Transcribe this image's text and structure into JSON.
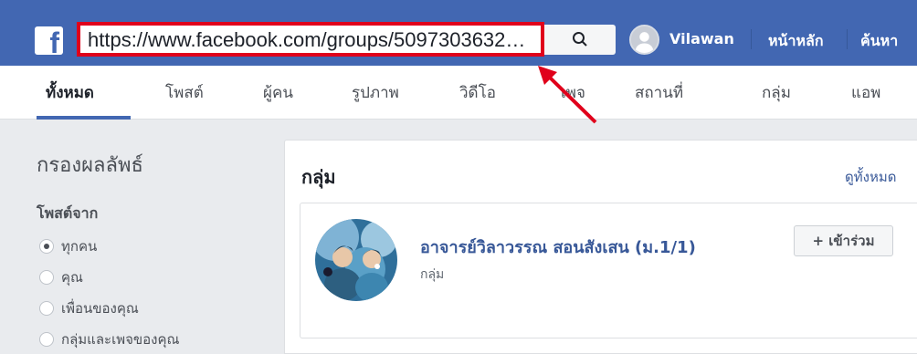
{
  "header": {
    "logo_letter": "f",
    "url": "https://www.facebook.com/groups/5097303632…",
    "user_name": "Vilawan",
    "home_label": "หน้าหลัก",
    "find_label": "ค้นหา"
  },
  "tabs": [
    {
      "label": "ทั้งหมด"
    },
    {
      "label": "โพสต์"
    },
    {
      "label": "ผู้คน"
    },
    {
      "label": "รูปภาพ"
    },
    {
      "label": "วิดีโอ"
    },
    {
      "label": "เพจ"
    },
    {
      "label": "สถานที่"
    },
    {
      "label": "กลุ่ม"
    },
    {
      "label": "แอพ"
    }
  ],
  "filter": {
    "title": "กรองผลลัพธ์",
    "posts_from_label": "โพสต์จาก",
    "options": [
      {
        "label": "ทุกคน",
        "checked": true
      },
      {
        "label": "คุณ",
        "checked": false
      },
      {
        "label": "เพื่อนของคุณ",
        "checked": false
      },
      {
        "label": "กลุ่มและเพจของคุณ",
        "checked": false
      }
    ]
  },
  "results": {
    "section_title": "กลุ่ม",
    "see_all": "ดูทั้งหมด",
    "group": {
      "name": "อาจารย์วิลาวรรณ สอนสังเสน (ม.1/1)",
      "type": "กลุ่ม",
      "join_label": "+ เข้าร่วม"
    }
  },
  "colors": {
    "brand_blue": "#4267b2",
    "highlight_red": "#e0001b",
    "link_blue": "#385898"
  }
}
